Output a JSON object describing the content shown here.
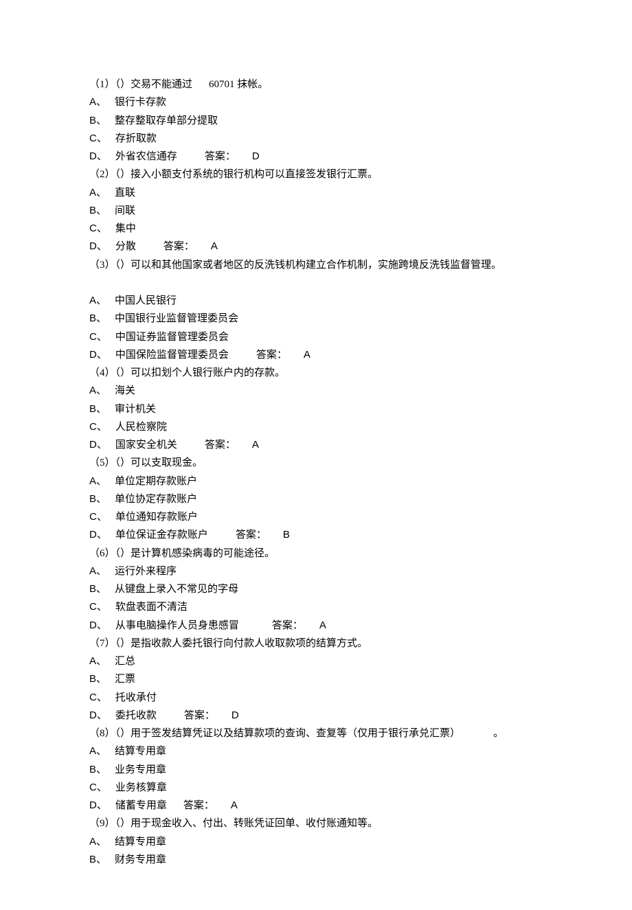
{
  "questions": [
    {
      "qtext": "（1）（）交易不能通过",
      "qextra": "60701 抹帐。",
      "options": [
        {
          "label": "A、",
          "text": "银行卡存款"
        },
        {
          "label": "B、",
          "text": "整存整取存单部分提取"
        },
        {
          "label": "C、",
          "text": "存折取款"
        },
        {
          "label": "D、",
          "text": "外省农信通存"
        }
      ],
      "answer_label": "答案：",
      "answer": "D",
      "inline_answer": true
    },
    {
      "qtext": "（2）（）接入小额支付系统的银行机构可以直接签发银行汇票。",
      "options": [
        {
          "label": "A、",
          "text": "直联"
        },
        {
          "label": "B、",
          "text": "间联"
        },
        {
          "label": "C、",
          "text": "集中"
        },
        {
          "label": "D、",
          "text": "分散"
        }
      ],
      "answer_label": "答案：",
      "answer": "A",
      "inline_answer": true
    },
    {
      "qtext": "（3）（）可以和其他国家或者地区的反洗钱机构建立合作机制，实施跨境反洗钱监督管理。",
      "blank_after": true,
      "options": [
        {
          "label": "A、",
          "text": "中国人民银行"
        },
        {
          "label": "B、",
          "text": "中国银行业监督管理委员会"
        },
        {
          "label": "C、",
          "text": "中国证券监督管理委员会"
        },
        {
          "label": "D、",
          "text": "中国保险监督管理委员会"
        }
      ],
      "answer_label": "答案：",
      "answer": "A",
      "inline_answer": true
    },
    {
      "qtext": "（4）（）可以扣划个人银行账户内的存款。",
      "options": [
        {
          "label": "A、",
          "text": "海关"
        },
        {
          "label": "B、",
          "text": "审计机关"
        },
        {
          "label": "C、",
          "text": "人民检察院"
        },
        {
          "label": "D、",
          "text": "国家安全机关"
        }
      ],
      "answer_label": "答案：",
      "answer": "A",
      "inline_answer": true
    },
    {
      "qtext": "（5）（）可以支取现金。",
      "options": [
        {
          "label": "A、",
          "text": "单位定期存款账户"
        },
        {
          "label": "B、",
          "text": "单位协定存款账户"
        },
        {
          "label": "C、",
          "text": "单位通知存款账户"
        },
        {
          "label": "D、",
          "text": "单位保证金存款账户"
        }
      ],
      "answer_label": "答案：",
      "answer": "B",
      "inline_answer": true
    },
    {
      "qtext": "（6）（）是计算机感染病毒的可能途径。",
      "options": [
        {
          "label": "A、",
          "text": "运行外来程序"
        },
        {
          "label": "B、",
          "text": "从键盘上录入不常见的字母"
        },
        {
          "label": "C、",
          "text": "软盘表面不清洁"
        },
        {
          "label": "D、",
          "text": "从事电脑操作人员身患感冒"
        }
      ],
      "answer_label": "答案：",
      "answer": "A",
      "inline_answer": true,
      "wide_gap": true
    },
    {
      "qtext": "（7）（）是指收款人委托银行向付款人收取款项的结算方式。",
      "options": [
        {
          "label": "A、",
          "text": "汇总"
        },
        {
          "label": "B、",
          "text": "汇票"
        },
        {
          "label": "C、",
          "text": "托收承付"
        },
        {
          "label": "D、",
          "text": "委托收款"
        }
      ],
      "answer_label": "答案：",
      "answer": "D",
      "inline_answer": true
    },
    {
      "qtext": "（8）（）用于签发结算凭证以及结算款项的查询、查复等（仅用于银行承兑汇票）",
      "qtail": "。",
      "options": [
        {
          "label": "A、",
          "text": "结算专用章"
        },
        {
          "label": "B、",
          "text": "业务专用章"
        },
        {
          "label": "C、",
          "text": "业务核算章"
        },
        {
          "label": "D、",
          "text": "储蓄专用章"
        }
      ],
      "answer_label": "答案：",
      "answer": "A",
      "inline_answer": true,
      "tight_gap": true
    },
    {
      "qtext": "（9）（）用于现金收入、付出、转账凭证回单、收付账通知等。",
      "options": [
        {
          "label": "A、",
          "text": "结算专用章"
        },
        {
          "label": "B、",
          "text": "财务专用章"
        }
      ]
    }
  ]
}
